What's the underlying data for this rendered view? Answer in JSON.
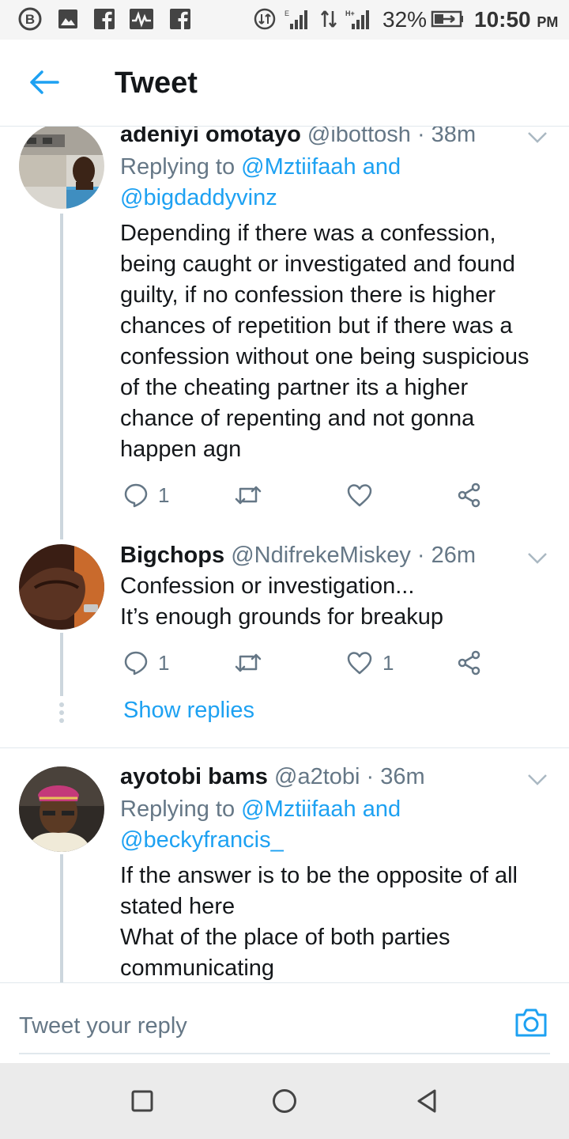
{
  "status_bar": {
    "battery": "32%",
    "time": "10:50",
    "ampm": "PM",
    "icons": [
      "b-circle-icon",
      "image-icon",
      "facebook-icon",
      "pulse-icon",
      "facebook-icon",
      "data-saver-icon",
      "signal-icon",
      "data-arrows-icon",
      "signal-h-icon",
      "battery-icon"
    ]
  },
  "header": {
    "title": "Tweet"
  },
  "tweets": [
    {
      "name": "adeniyi omotayo",
      "handle": "@ibottosh",
      "time": "· 38m",
      "replying_prefix": "Replying to ",
      "replying_mentions_a": "@Mztiifaah and",
      "replying_mentions_b": "@bigdaddyvinz",
      "text": "Depending if there was a confession,\nbeing caught or investigated and found\nguilty, if no confession there is higher\nchances of repetition but if there was a\nconfession without one being suspicious\nof the cheating partner its a higher\nchance of repenting and not gonna\nhappen agn",
      "reply_count": "1",
      "like_count": ""
    },
    {
      "name": "Bigchops",
      "handle": "@NdifrekeMiskey",
      "time": "· 26m",
      "text": "Confession or investigation...\nIt’s enough grounds for breakup",
      "reply_count": "1",
      "like_count": "1"
    },
    {
      "name": "ayotobi bams",
      "handle": "@a2tobi",
      "time": "· 36m",
      "replying_prefix": "Replying to ",
      "replying_mentions_a": "@Mztiifaah and",
      "replying_mentions_b": "@beckyfrancis_",
      "text": "If the answer is to be the opposite of all\nstated here\nWhat of the place of both parties\ncommunicating"
    }
  ],
  "show_replies": "Show replies",
  "reply_box": {
    "placeholder": "Tweet your reply"
  },
  "colors": {
    "accent": "#1da1f2",
    "secondary_text": "#657786",
    "thread_line": "#ccd6dd"
  }
}
